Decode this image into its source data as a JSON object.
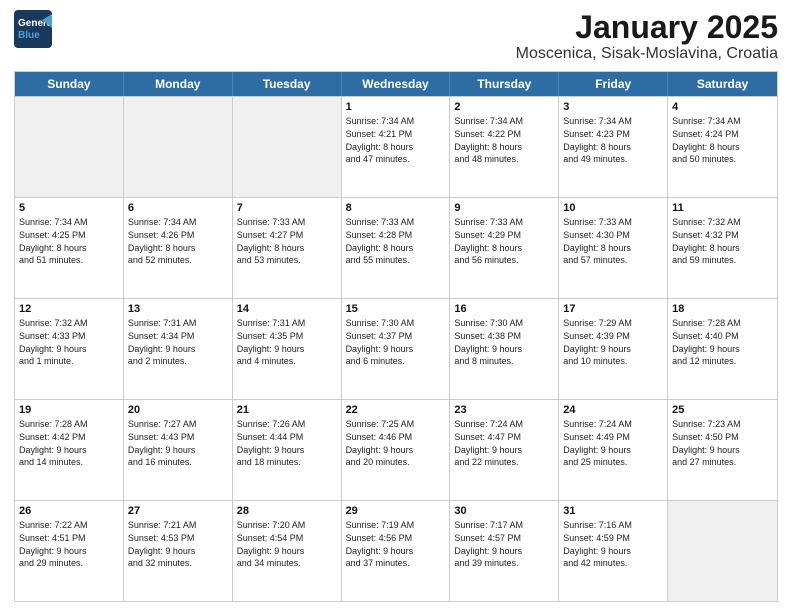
{
  "header": {
    "logo_line1": "General",
    "logo_line2": "Blue",
    "title": "January 2025",
    "subtitle": "Moscenica, Sisak-Moslavina, Croatia"
  },
  "days": [
    "Sunday",
    "Monday",
    "Tuesday",
    "Wednesday",
    "Thursday",
    "Friday",
    "Saturday"
  ],
  "rows": [
    [
      {
        "day": "",
        "lines": []
      },
      {
        "day": "",
        "lines": []
      },
      {
        "day": "",
        "lines": []
      },
      {
        "day": "1",
        "lines": [
          "Sunrise: 7:34 AM",
          "Sunset: 4:21 PM",
          "Daylight: 8 hours",
          "and 47 minutes."
        ]
      },
      {
        "day": "2",
        "lines": [
          "Sunrise: 7:34 AM",
          "Sunset: 4:22 PM",
          "Daylight: 8 hours",
          "and 48 minutes."
        ]
      },
      {
        "day": "3",
        "lines": [
          "Sunrise: 7:34 AM",
          "Sunset: 4:23 PM",
          "Daylight: 8 hours",
          "and 49 minutes."
        ]
      },
      {
        "day": "4",
        "lines": [
          "Sunrise: 7:34 AM",
          "Sunset: 4:24 PM",
          "Daylight: 8 hours",
          "and 50 minutes."
        ]
      }
    ],
    [
      {
        "day": "5",
        "lines": [
          "Sunrise: 7:34 AM",
          "Sunset: 4:25 PM",
          "Daylight: 8 hours",
          "and 51 minutes."
        ]
      },
      {
        "day": "6",
        "lines": [
          "Sunrise: 7:34 AM",
          "Sunset: 4:26 PM",
          "Daylight: 8 hours",
          "and 52 minutes."
        ]
      },
      {
        "day": "7",
        "lines": [
          "Sunrise: 7:33 AM",
          "Sunset: 4:27 PM",
          "Daylight: 8 hours",
          "and 53 minutes."
        ]
      },
      {
        "day": "8",
        "lines": [
          "Sunrise: 7:33 AM",
          "Sunset: 4:28 PM",
          "Daylight: 8 hours",
          "and 55 minutes."
        ]
      },
      {
        "day": "9",
        "lines": [
          "Sunrise: 7:33 AM",
          "Sunset: 4:29 PM",
          "Daylight: 8 hours",
          "and 56 minutes."
        ]
      },
      {
        "day": "10",
        "lines": [
          "Sunrise: 7:33 AM",
          "Sunset: 4:30 PM",
          "Daylight: 8 hours",
          "and 57 minutes."
        ]
      },
      {
        "day": "11",
        "lines": [
          "Sunrise: 7:32 AM",
          "Sunset: 4:32 PM",
          "Daylight: 8 hours",
          "and 59 minutes."
        ]
      }
    ],
    [
      {
        "day": "12",
        "lines": [
          "Sunrise: 7:32 AM",
          "Sunset: 4:33 PM",
          "Daylight: 9 hours",
          "and 1 minute."
        ]
      },
      {
        "day": "13",
        "lines": [
          "Sunrise: 7:31 AM",
          "Sunset: 4:34 PM",
          "Daylight: 9 hours",
          "and 2 minutes."
        ]
      },
      {
        "day": "14",
        "lines": [
          "Sunrise: 7:31 AM",
          "Sunset: 4:35 PM",
          "Daylight: 9 hours",
          "and 4 minutes."
        ]
      },
      {
        "day": "15",
        "lines": [
          "Sunrise: 7:30 AM",
          "Sunset: 4:37 PM",
          "Daylight: 9 hours",
          "and 6 minutes."
        ]
      },
      {
        "day": "16",
        "lines": [
          "Sunrise: 7:30 AM",
          "Sunset: 4:38 PM",
          "Daylight: 9 hours",
          "and 8 minutes."
        ]
      },
      {
        "day": "17",
        "lines": [
          "Sunrise: 7:29 AM",
          "Sunset: 4:39 PM",
          "Daylight: 9 hours",
          "and 10 minutes."
        ]
      },
      {
        "day": "18",
        "lines": [
          "Sunrise: 7:28 AM",
          "Sunset: 4:40 PM",
          "Daylight: 9 hours",
          "and 12 minutes."
        ]
      }
    ],
    [
      {
        "day": "19",
        "lines": [
          "Sunrise: 7:28 AM",
          "Sunset: 4:42 PM",
          "Daylight: 9 hours",
          "and 14 minutes."
        ]
      },
      {
        "day": "20",
        "lines": [
          "Sunrise: 7:27 AM",
          "Sunset: 4:43 PM",
          "Daylight: 9 hours",
          "and 16 minutes."
        ]
      },
      {
        "day": "21",
        "lines": [
          "Sunrise: 7:26 AM",
          "Sunset: 4:44 PM",
          "Daylight: 9 hours",
          "and 18 minutes."
        ]
      },
      {
        "day": "22",
        "lines": [
          "Sunrise: 7:25 AM",
          "Sunset: 4:46 PM",
          "Daylight: 9 hours",
          "and 20 minutes."
        ]
      },
      {
        "day": "23",
        "lines": [
          "Sunrise: 7:24 AM",
          "Sunset: 4:47 PM",
          "Daylight: 9 hours",
          "and 22 minutes."
        ]
      },
      {
        "day": "24",
        "lines": [
          "Sunrise: 7:24 AM",
          "Sunset: 4:49 PM",
          "Daylight: 9 hours",
          "and 25 minutes."
        ]
      },
      {
        "day": "25",
        "lines": [
          "Sunrise: 7:23 AM",
          "Sunset: 4:50 PM",
          "Daylight: 9 hours",
          "and 27 minutes."
        ]
      }
    ],
    [
      {
        "day": "26",
        "lines": [
          "Sunrise: 7:22 AM",
          "Sunset: 4:51 PM",
          "Daylight: 9 hours",
          "and 29 minutes."
        ]
      },
      {
        "day": "27",
        "lines": [
          "Sunrise: 7:21 AM",
          "Sunset: 4:53 PM",
          "Daylight: 9 hours",
          "and 32 minutes."
        ]
      },
      {
        "day": "28",
        "lines": [
          "Sunrise: 7:20 AM",
          "Sunset: 4:54 PM",
          "Daylight: 9 hours",
          "and 34 minutes."
        ]
      },
      {
        "day": "29",
        "lines": [
          "Sunrise: 7:19 AM",
          "Sunset: 4:56 PM",
          "Daylight: 9 hours",
          "and 37 minutes."
        ]
      },
      {
        "day": "30",
        "lines": [
          "Sunrise: 7:17 AM",
          "Sunset: 4:57 PM",
          "Daylight: 9 hours",
          "and 39 minutes."
        ]
      },
      {
        "day": "31",
        "lines": [
          "Sunrise: 7:16 AM",
          "Sunset: 4:59 PM",
          "Daylight: 9 hours",
          "and 42 minutes."
        ]
      },
      {
        "day": "",
        "lines": []
      }
    ]
  ]
}
